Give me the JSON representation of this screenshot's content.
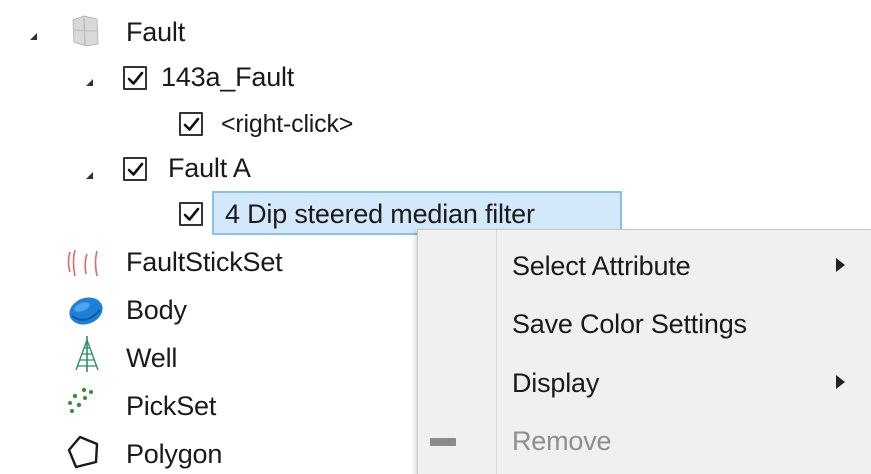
{
  "tree": {
    "items": [
      {
        "label": "Fault",
        "icon": "fault-surface-icon",
        "expanded": true
      },
      {
        "label": "143a_Fault",
        "checked": true,
        "expanded": true
      },
      {
        "label": "<right-click>",
        "checked": true
      },
      {
        "label": "Fault A",
        "checked": true,
        "expanded": true
      },
      {
        "label": "4 Dip steered median filter",
        "checked": true,
        "selected": true
      },
      {
        "label": "FaultStickSet",
        "icon": "fault-stick-set-icon"
      },
      {
        "label": "Body",
        "icon": "body-icon"
      },
      {
        "label": "Well",
        "icon": "well-icon"
      },
      {
        "label": "PickSet",
        "icon": "pickset-icon"
      },
      {
        "label": "Polygon",
        "icon": "polygon-icon"
      }
    ]
  },
  "context_menu": {
    "items": [
      {
        "label": "Select Attribute",
        "has_submenu": true,
        "enabled": true
      },
      {
        "label": "Save Color Settings",
        "has_submenu": false,
        "enabled": true
      },
      {
        "label": "Display",
        "has_submenu": true,
        "enabled": true
      },
      {
        "label": "Remove",
        "has_submenu": false,
        "enabled": false,
        "icon": "remove-dash-icon"
      }
    ]
  },
  "colors": {
    "selection_fill": "#d4e8fb",
    "selection_border": "#8bbfe8",
    "menu_background": "#f0f0f0",
    "disabled_text": "#8e8e8e",
    "body_icon_blue": "#1e7fd8",
    "fault_stick_red": "#e06a6a",
    "well_icon_green": "#2f8f6a",
    "pickset_icon_green": "#3a8f3a"
  }
}
